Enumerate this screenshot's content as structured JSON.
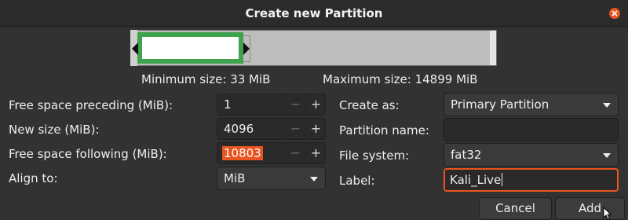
{
  "window": {
    "title": "Create new Partition"
  },
  "sizes": {
    "min": "Minimum size: 33 MiB",
    "max": "Maximum size: 14899 MiB"
  },
  "left": {
    "preceding_label": "Free space preceding (MiB):",
    "preceding_value": "1",
    "newsize_label": "New size (MiB):",
    "newsize_value": "4096",
    "following_label": "Free space following (MiB):",
    "following_value": "10803",
    "align_label": "Align to:",
    "align_value": "MiB",
    "minus": "−",
    "plus": "+"
  },
  "right": {
    "create_label": "Create as:",
    "create_value": "Primary Partition",
    "name_label": "Partition name:",
    "name_value": "",
    "fs_label": "File system:",
    "fs_value": "fat32",
    "label_label": "Label:",
    "label_value": "Kali_Live"
  },
  "buttons": {
    "cancel": "Cancel",
    "add": "Add"
  },
  "colors": {
    "accent": "#e95420",
    "partition": "#3fa34d"
  }
}
